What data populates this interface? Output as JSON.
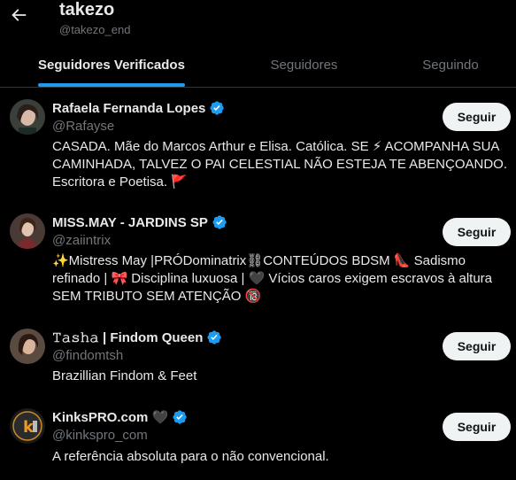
{
  "header": {
    "title": "takezo",
    "handle": "@takezo_end"
  },
  "tabs": [
    {
      "label": "Seguidores Verificados",
      "active": true
    },
    {
      "label": "Seguidores",
      "active": false
    },
    {
      "label": "Seguindo",
      "active": false
    }
  ],
  "users": [
    {
      "name": "Rafaela Fernanda Lopes",
      "handle": "@Rafayse",
      "bio_lines": [
        "CASADA. Mãe do Marcos Arthur e Elisa. Católica. SE ⚡ ACOMPANHA SUA",
        "CAMINHADA, TALVEZ O PAI CELESTIAL NÃO ESTEJA TE ABENÇOANDO.",
        "Escritora e Poetisa. 🚩"
      ],
      "follow_label": "Seguir",
      "verified": true
    },
    {
      "name": "MISS.MAY - JARDINS SP",
      "handle": "@zaiintrix",
      "bio_lines": [
        "✨Mistress May |PRÓDominatrix⛓CONTEÚDOS BDSM 👠 Sadismo",
        "refinado | 🎀 Disciplina luxuosa | 🖤 Vícios caros exigem escravos à altura",
        "SEM TRIBUTO SEM ATENÇÃO 🔞"
      ],
      "follow_label": "Seguir",
      "verified": true
    },
    {
      "name": "𝚃𝚊𝚜𝚑𝚊 | Findom Queen",
      "handle": "@findomtsh",
      "bio_lines": [
        "Brazillian Findom & Feet"
      ],
      "follow_label": "Seguir",
      "verified": true
    },
    {
      "name": "KinksPRO.com 🖤",
      "handle": "@kinkspro_com",
      "bio_lines": [
        "A referência absoluta para o não convencional."
      ],
      "follow_label": "Seguir",
      "verified": true
    }
  ],
  "icons": {
    "back": "arrow-left-icon",
    "verified": "verified-badge-icon"
  },
  "colors": {
    "accent": "#1d9bf0",
    "background": "#000000",
    "muted": "#71767b"
  }
}
